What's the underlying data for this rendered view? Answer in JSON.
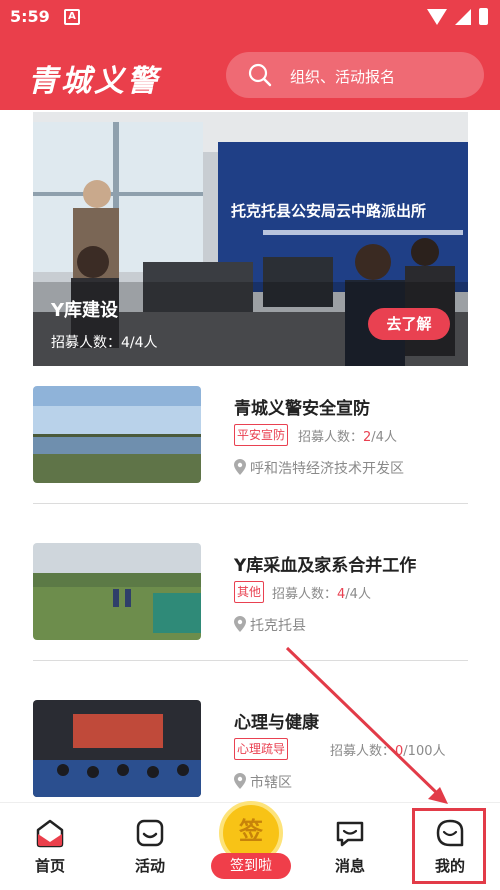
{
  "status_bar": {
    "time": "5:59",
    "app_badge": "A"
  },
  "header": {
    "brand": "青城义警",
    "search_placeholder": "组织、活动报名"
  },
  "banner": {
    "title": "Y库建设",
    "recruit_label": "招募人数：",
    "recruit_value": "4/4人",
    "button_label": "去了解",
    "sign_text": "托克托县公安局云中路派出所"
  },
  "activities": [
    {
      "title": "青城义警安全宣防",
      "tag": "平安宣防",
      "recruit_label": "招募人数：",
      "current": "2",
      "total": "/4人",
      "location": "呼和浩特经济技术开发区"
    },
    {
      "title": "Y库采血及家系合并工作",
      "tag": "其他",
      "recruit_label": "招募人数：",
      "current": "4",
      "total": "/4人",
      "location": "托克托县"
    },
    {
      "title": "心理与健康",
      "tag": "心理疏导",
      "recruit_label": "招募人数：",
      "current": "0",
      "total": "/100人",
      "location": "市辖区"
    }
  ],
  "bottom_nav": {
    "home": "首页",
    "activity": "活动",
    "signin_glyph": "签",
    "signin": "签到啦",
    "messages": "消息",
    "mine": "我的"
  },
  "colors": {
    "primary": "#ea3f4b",
    "coin": "#f8c316"
  }
}
